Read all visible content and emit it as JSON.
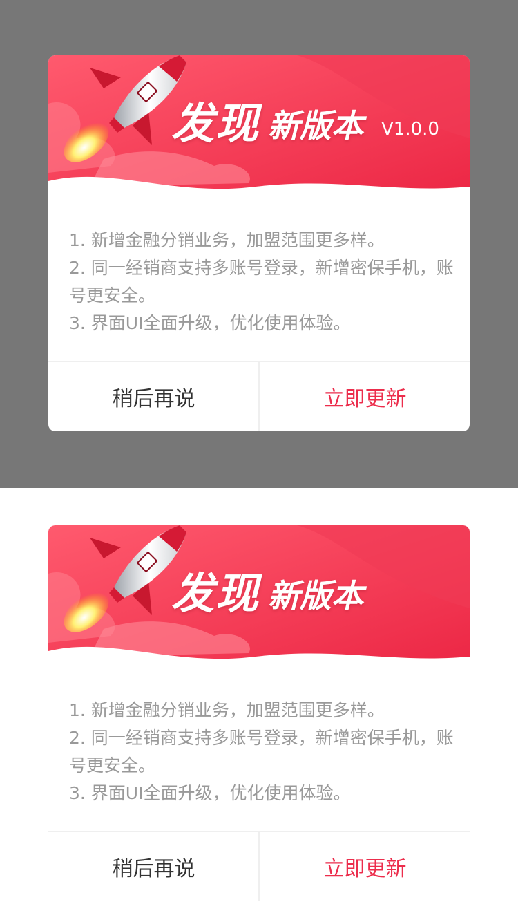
{
  "colors": {
    "overlay": "#777777",
    "accent": "#ec2d4c",
    "banner_start": "#ff5268",
    "banner_end": "#ee2847",
    "notes_text": "#999999",
    "button_text": "#333333"
  },
  "dialogs": [
    {
      "variant": "with-overlay",
      "title_main": "发现",
      "title_sub": "新版本",
      "version": "V1.0.0",
      "notes": [
        "1. 新增金融分销业务，加盟范围更多样。",
        "2. 同一经销商支持多账号登录，新增密保手机，账号更安全。",
        "3. 界面UI全面升级，优化使用体验。"
      ],
      "later_label": "稍后再说",
      "update_label": "立即更新"
    },
    {
      "variant": "plain",
      "title_main": "发现",
      "title_sub": "新版本",
      "version": "",
      "notes": [
        "1. 新增金融分销业务，加盟范围更多样。",
        "2. 同一经销商支持多账号登录，新增密保手机，账号更安全。",
        "3. 界面UI全面升级，优化使用体验。"
      ],
      "later_label": "稍后再说",
      "update_label": "立即更新"
    }
  ],
  "icons": {
    "rocket": "rocket-icon"
  }
}
